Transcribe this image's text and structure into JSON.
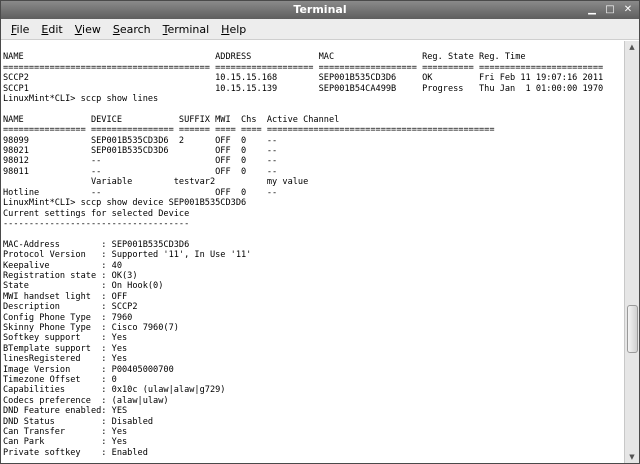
{
  "window": {
    "title": "Terminal",
    "controls": {
      "minimize": "▁",
      "maximize": "□",
      "close": "✕"
    }
  },
  "menu": {
    "file": {
      "accel": "F",
      "rest": "ile"
    },
    "edit": {
      "accel": "E",
      "rest": "dit"
    },
    "view": {
      "accel": "V",
      "rest": "iew"
    },
    "search": {
      "accel": "S",
      "rest": "earch"
    },
    "terminal": {
      "accel": "T",
      "rest": "erminal"
    },
    "help": {
      "accel": "H",
      "rest": "elp"
    }
  },
  "terminal": {
    "lines": [
      "",
      "NAME                                     ADDRESS             MAC                 Reg. State Reg. Time",
      "======================================== =================== =================== ========== ========================",
      "SCCP2                                    10.15.15.168        SEP001B535CD3D6     OK         Fri Feb 11 19:07:16 2011",
      "SCCP1                                    10.15.15.139        SEP001B54CA499B     Progress   Thu Jan  1 01:00:00 1970",
      "LinuxMint*CLI> sccp show lines",
      "",
      "NAME             DEVICE           SUFFIX MWI  Chs  Active Channel",
      "================ ================ ====== ==== ==== ============================================",
      "98099            SEP001B535CD3D6  2      OFF  0    --",
      "98021            SEP001B535CD3D6         OFF  0    --",
      "98012            --                      OFF  0    --",
      "98011            --                      OFF  0    --",
      "                 Variable        testvar2          my value",
      "Hotline          --                      OFF  0    --",
      "LinuxMint*CLI> sccp show device SEP001B535CD3D6",
      "Current settings for selected Device",
      "------------------------------------",
      "",
      "MAC-Address        : SEP001B535CD3D6",
      "Protocol Version   : Supported '11', In Use '11'",
      "Keepalive          : 40",
      "Registration state : OK(3)",
      "State              : On Hook(0)",
      "MWI handset light  : OFF",
      "Description        : SCCP2",
      "Config Phone Type  : 7960",
      "Skinny Phone Type  : Cisco 7960(7)",
      "Softkey support    : Yes",
      "BTemplate support  : Yes",
      "linesRegistered    : Yes",
      "Image Version      : P00405000700",
      "Timezone Offset    : 0",
      "Capabilities       : 0x10c (ulaw|alaw|g729)",
      "Codecs preference  : (alaw|ulaw)",
      "DND Feature enabled: YES",
      "DND Status         : Disabled",
      "Can Transfer       : Yes",
      "Can Park           : Yes",
      "Private softkey    : Enabled"
    ]
  },
  "scrollbar": {
    "position": 0.72,
    "up_icon": "▲",
    "down_icon": "▼"
  },
  "colors": {
    "titlebar": "#6e6e6e",
    "menubar": "#ededed",
    "terminal_bg": "#ffffff",
    "terminal_fg": "#000000"
  }
}
